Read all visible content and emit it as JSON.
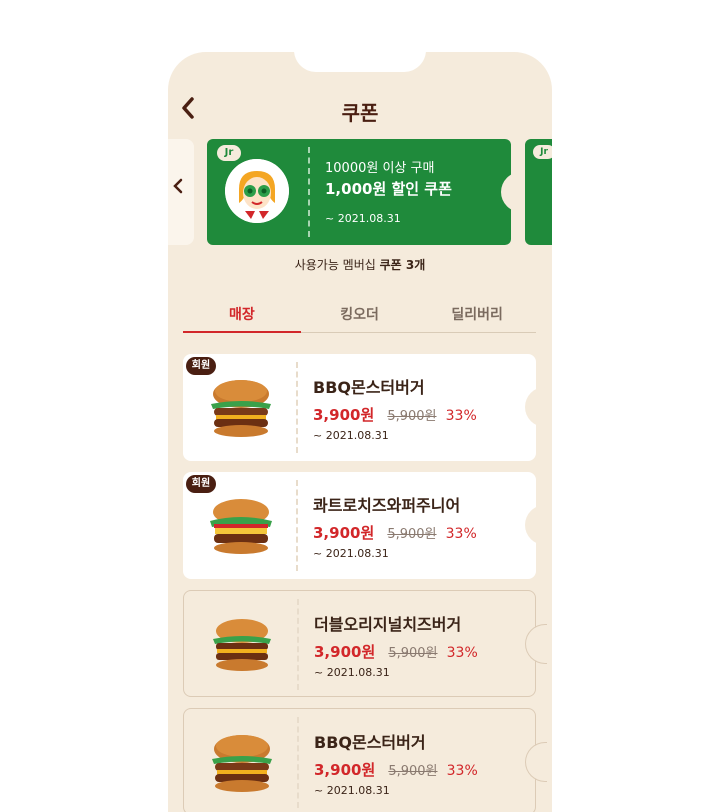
{
  "header": {
    "back_icon": "chevron-left-icon",
    "title": "쿠폰"
  },
  "hero_coupon": {
    "badge": "Jr",
    "line1": "10000원 이상 구매",
    "line2": "1,000원 할인 쿠폰",
    "expiry": "~ 2021.08.31",
    "color": "#1f8a3b"
  },
  "next_coupon": {
    "badge": "Jr"
  },
  "available": {
    "prefix": "사용가능 멤버십",
    "value": "쿠폰 3개"
  },
  "tabs": [
    {
      "label": "매장",
      "active": true
    },
    {
      "label": "킹오더",
      "active": false
    },
    {
      "label": "딜리버리",
      "active": false
    }
  ],
  "coupons": [
    {
      "badge": "회원",
      "name": "BBQ몬스터버거",
      "price": "3,900원",
      "original": "5,900원",
      "discount": "33%",
      "expiry": "~ 2021.08.31"
    },
    {
      "badge": "회원",
      "name": "콰트로치즈와퍼주니어",
      "price": "3,900원",
      "original": "5,900원",
      "discount": "33%",
      "expiry": "~ 2021.08.31"
    },
    {
      "badge": "",
      "name": "더블오리지널치즈버거",
      "price": "3,900원",
      "original": "5,900원",
      "discount": "33%",
      "expiry": "~ 2021.08.31"
    },
    {
      "badge": "",
      "name": "BBQ몬스터버거",
      "price": "3,900원",
      "original": "5,900원",
      "discount": "33%",
      "expiry": "~ 2021.08.31"
    }
  ],
  "colors": {
    "accent": "#d2272a",
    "brand_brown": "#4a1f12",
    "background": "#f5ebdc"
  }
}
